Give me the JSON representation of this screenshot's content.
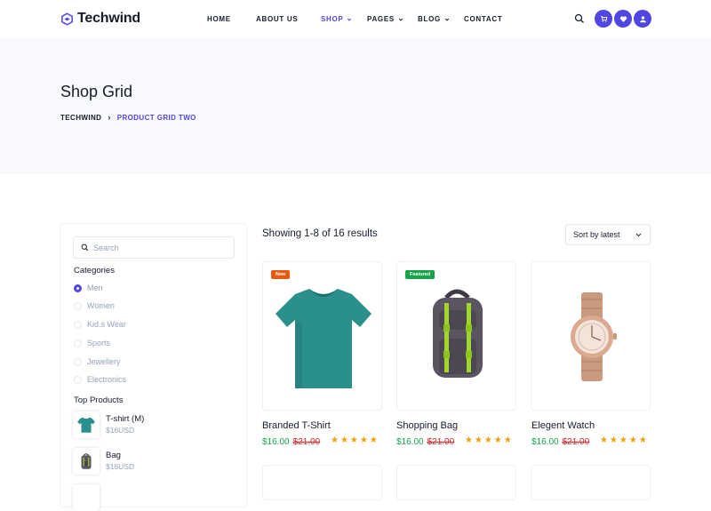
{
  "brand": {
    "name": "Techwind",
    "color": "#4f46e5"
  },
  "nav": {
    "items": [
      {
        "label": "HOME"
      },
      {
        "label": "ABOUT US"
      },
      {
        "label": "SHOP"
      },
      {
        "label": "PAGES"
      },
      {
        "label": "BLOG"
      },
      {
        "label": "CONTACT"
      }
    ],
    "active": "SHOP",
    "icons": [
      "search-icon",
      "cart-icon",
      "heart-icon",
      "user-icon"
    ]
  },
  "hero": {
    "title": "Shop Grid",
    "breadcrumb": [
      "TECHWIND",
      "PRODUCT GRID TWO"
    ]
  },
  "sidebar": {
    "search_placeholder": "Search",
    "categories_title": "Categories",
    "categories": [
      {
        "label": "Men",
        "selected": true
      },
      {
        "label": "Women",
        "selected": false
      },
      {
        "label": "Kid.s Wear",
        "selected": false
      },
      {
        "label": "Sports",
        "selected": false
      },
      {
        "label": "Jewellery",
        "selected": false
      },
      {
        "label": "Electronics",
        "selected": false
      }
    ],
    "top_title": "Top Products",
    "top_products": [
      {
        "name": "T-shirt (M)",
        "price": "$16USD"
      },
      {
        "name": "Bag",
        "price": "$16USD"
      }
    ]
  },
  "results": {
    "text": "Showing 1-8 of 16 results",
    "sort_label": "Sort by latest"
  },
  "products": [
    {
      "name": "Branded T-Shirt",
      "price": "$16.00",
      "old_price": "$21.00",
      "badge": "New",
      "rating": 5
    },
    {
      "name": "Shopping Bag",
      "price": "$16.00",
      "old_price": "$21.00",
      "badge": "Featured",
      "rating": 5
    },
    {
      "name": "Elegent Watch",
      "price": "$16.00",
      "old_price": "$21.00",
      "badge": "",
      "rating": 5
    }
  ],
  "colors": {
    "accent": "#4f46e5",
    "price": "#16a34a",
    "old_price": "#dc2626",
    "star": "#f59e0b",
    "badge_new": "#ea580c",
    "badge_featured": "#16a34a"
  }
}
